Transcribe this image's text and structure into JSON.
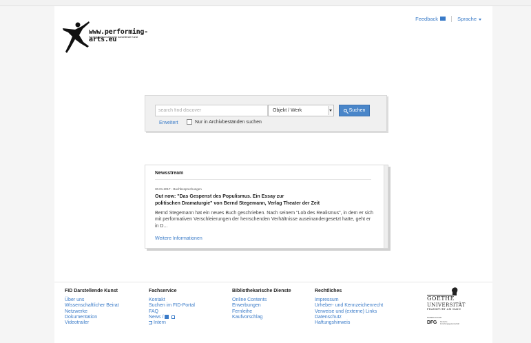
{
  "header": {
    "logo_text": "www.performing-arts.eu",
    "logo_subtitle": "Fachinformationsdienst für darstellende Kunst",
    "feedback_label": "Feedback",
    "language_label": "Sprache"
  },
  "search": {
    "placeholder": "search find discover",
    "category_selected": "Objekt / Werk",
    "submit_label": "Suchen",
    "advanced_label": "Erweitert",
    "archive_only_label": "Nur in Archivbeständen suchen"
  },
  "news": {
    "heading": "Newsstream",
    "meta": "30.01.2017 - Buchbesprechungen",
    "headline_line1": "Out now: \"Das Gespenst des Populismus. Ein Essay zur",
    "headline_line2": "politischen Dramaturgie\" von Bernd Stegemann, Verlag Theater der Zeit",
    "body": "Bernd Stegemann hat ein neues Buch geschrieben. Nach seinem \"Lob des Realismus\", in dem er sich mit performativen Verschleierungen der herrschenden Verhältnisse auseinandergesetzt hatte, geht er in D...",
    "more_label": "Weitere Informationen"
  },
  "footer": {
    "col1": {
      "title": "FID Darstellende Kunst",
      "links": [
        "Über uns",
        "Wissenschaftlicher Beirat",
        "Netzwerke",
        "Dokumentation",
        "Videotrailer"
      ]
    },
    "col2": {
      "title": "Fachservice",
      "links": [
        "Kontakt",
        "Suchen im FID-Portal",
        "FAQ",
        "News /",
        "Intern"
      ]
    },
    "col3": {
      "title": "Bibliothekarische Dienste",
      "links": [
        "Online Contents",
        "Erwerbungen",
        "Fernleihe",
        "Kaufvorschlag"
      ]
    },
    "col4": {
      "title": "Rechtliches",
      "links": [
        "Impressum",
        "Urheber- und Kennzeichenrecht",
        "Verweise und (externe) Links",
        "Datenschutz",
        "Haftungshinweis"
      ]
    },
    "goethe": {
      "name": "GOETHE",
      "university": "UNIVERSITÄT",
      "city": "FRANKFURT AM MAIN"
    },
    "dfg": {
      "label": "Gefördert durch:",
      "name": "DFG",
      "sub1": "Deutsche",
      "sub2": "Forschungsgemeinschaft"
    }
  },
  "colors": {
    "link": "#3a7bc8",
    "button": "#4a86c9"
  }
}
